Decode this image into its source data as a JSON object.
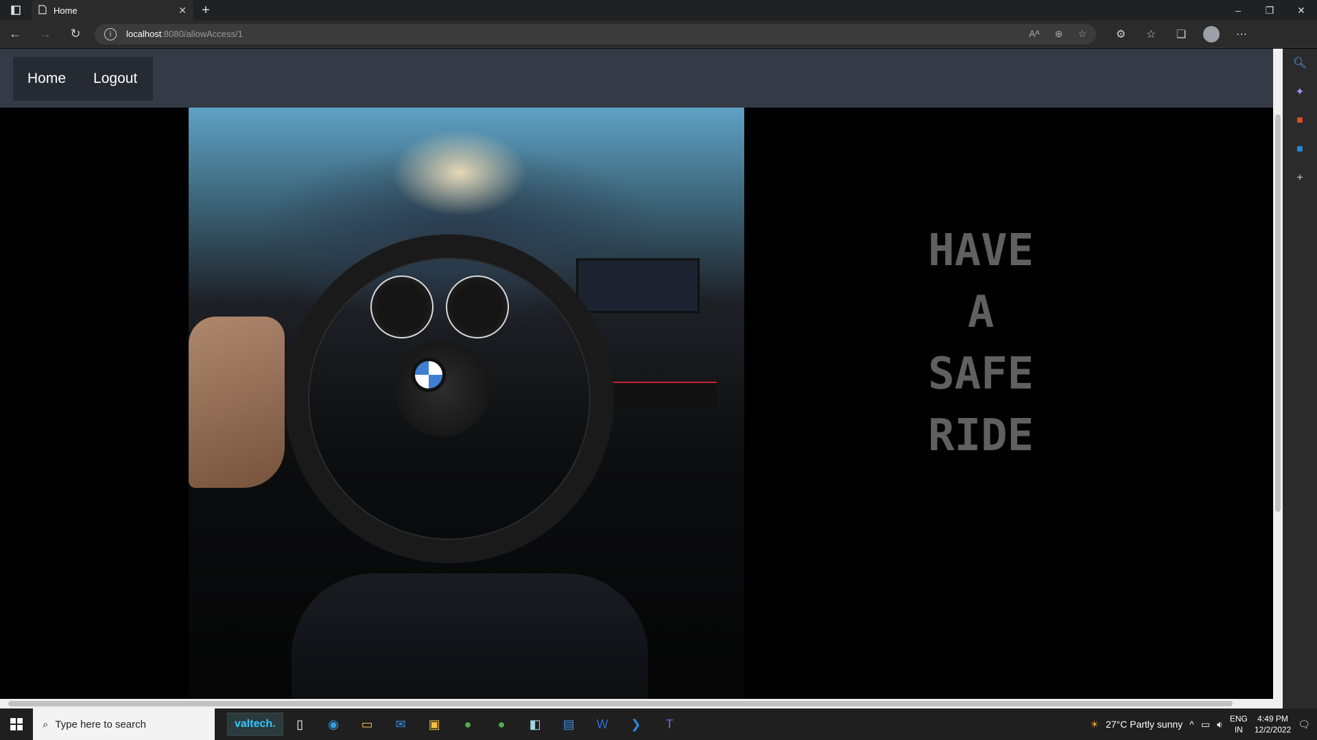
{
  "browser": {
    "tab_title": "Home",
    "new_tab_symbol": "+",
    "address_host": "localhost",
    "address_path": ":8080/allowAccess/1",
    "window_controls": [
      "–",
      "❐",
      "✕"
    ]
  },
  "site": {
    "nav": {
      "home": "Home",
      "logout": "Logout"
    },
    "slogan": [
      "HAVE",
      "A",
      "SAFE",
      "RIDE"
    ]
  },
  "taskbar": {
    "search_placeholder": "Type here to search",
    "pinned_label": "valtech.",
    "weather": "27°C  Partly sunny",
    "lang_top": "ENG",
    "lang_bottom": "IN",
    "time": "4:49 PM",
    "date": "12/2/2022"
  },
  "colors": {
    "nav_bg": "#343a46",
    "accent": "#35c6ff",
    "slogan": "#606060"
  }
}
